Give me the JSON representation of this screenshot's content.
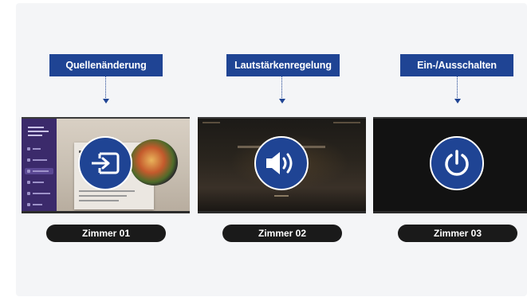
{
  "steps": [
    {
      "label": "Quellenänderung",
      "room": "Zimmer 01",
      "icon": "input-source-icon",
      "screen": "hotel-menu"
    },
    {
      "label": "Lautstärkenregelung",
      "room": "Zimmer 02",
      "icon": "volume-icon",
      "screen": "dim-lobby"
    },
    {
      "label": "Ein-/Ausschalten",
      "room": "Zimmer 03",
      "icon": "power-icon",
      "screen": "off"
    }
  ],
  "colors": {
    "accent": "#1f4494",
    "pill": "#1a1a1a",
    "panel": "#f4f5f7"
  }
}
